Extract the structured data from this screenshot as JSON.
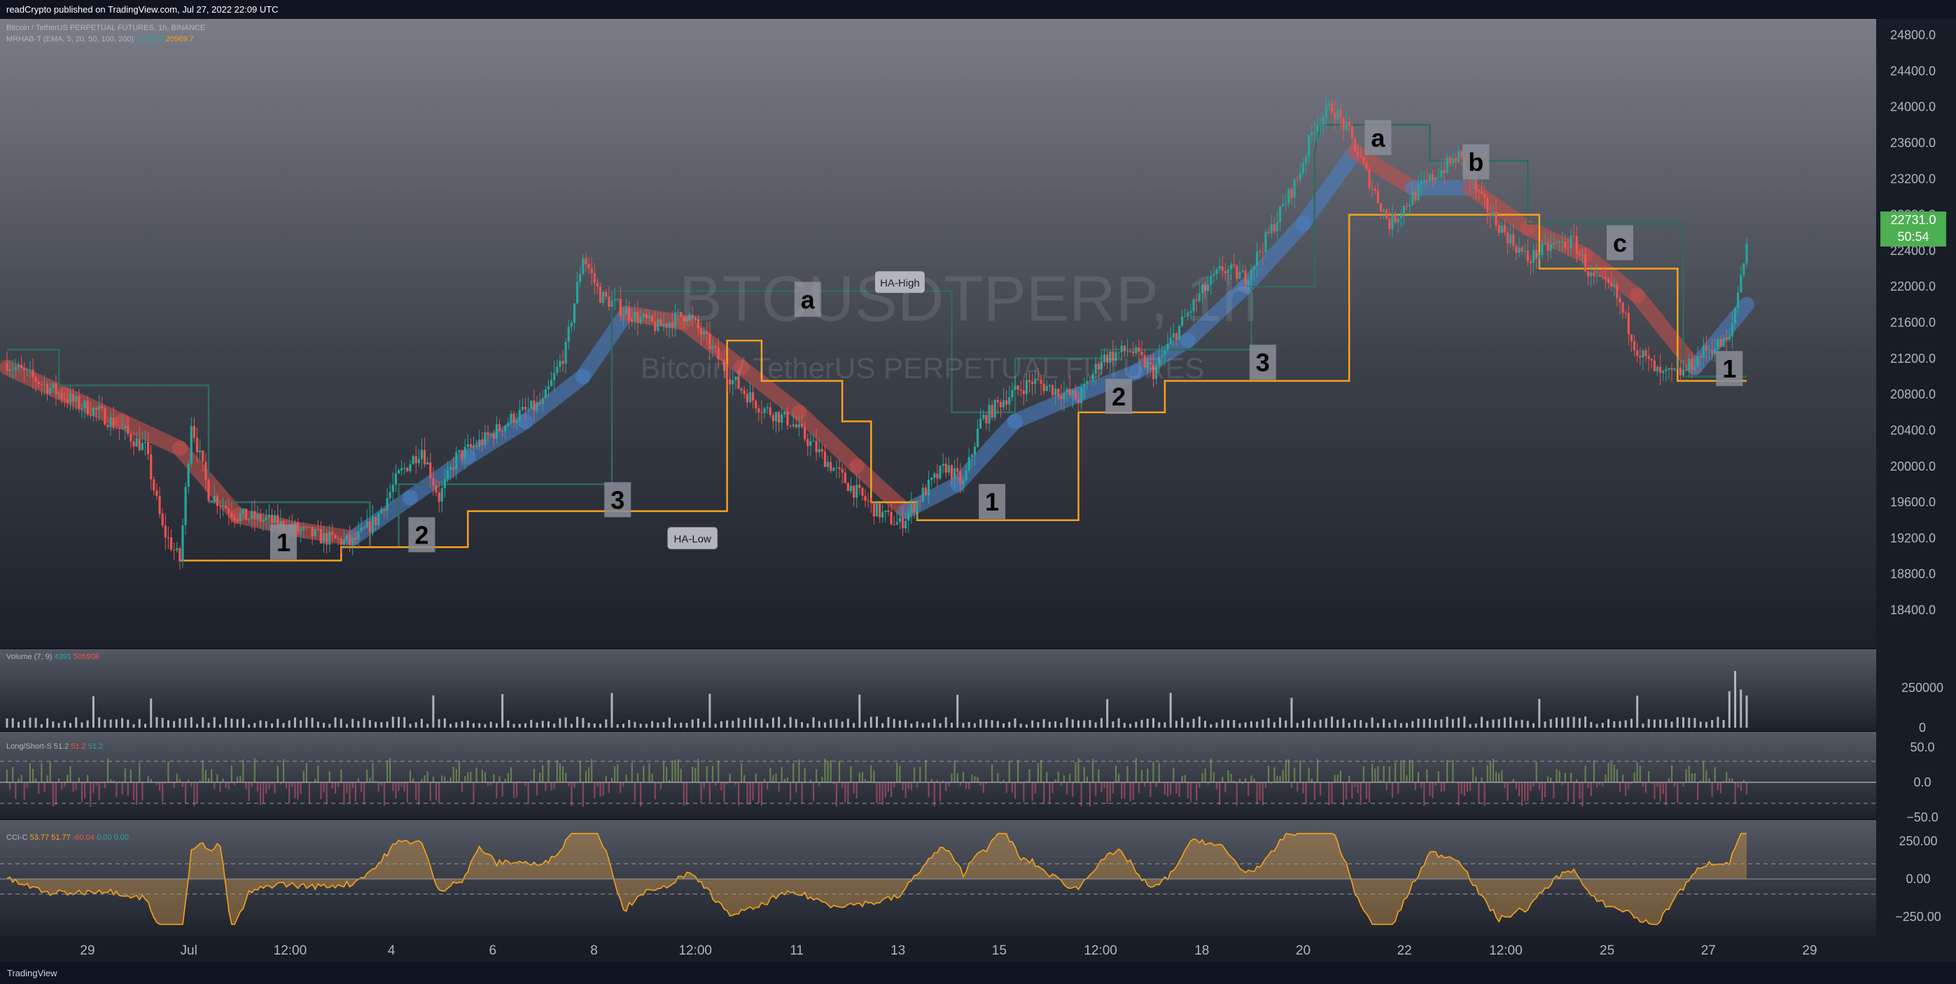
{
  "header_text": "readCrypto published on TradingView.com, Jul 27, 2022 22:09 UTC",
  "footer_logo": "TradingView",
  "symbol_legend": "Bitcoin / TetherUS PERPETUAL FUTURES, 1h, BINANCE",
  "indicator_legend": "MRHAB-T (EMA, 5, 20, 50, 100, 200)",
  "indicator_values": [
    "21248.2",
    "20969.7"
  ],
  "volume_legend": "Volume (7, 9)",
  "volume_values": [
    "4391",
    "505908"
  ],
  "ls_legend": "Long/Short-S",
  "ls_values": [
    "51.2",
    "51.2",
    "51.2"
  ],
  "cci_legend": "CCI-C",
  "cci_values": [
    "53.77",
    "51.77",
    "-60.04",
    "0.00",
    "0.00"
  ],
  "watermark_symbol": "BTCUSDTPERP, 1h",
  "watermark_name": "Bitcoin / TetherUS PERPETUAL FUTURES",
  "last_price": "22731.0",
  "countdown": "50:54",
  "colors": {
    "up": "#26a69a",
    "down": "#ef5350",
    "orange": "#f7a21b",
    "blue_ribbon": "#4a7fc1",
    "red_ribbon": "#c0504d",
    "darkgreen_line": "#2e6b5e",
    "cyan": "#25c5dc"
  },
  "chart_data": {
    "type": "candlestick",
    "price_axis": {
      "ticks": [
        18400,
        18800,
        19200,
        19600,
        20000,
        20400,
        20800,
        21200,
        21600,
        22000,
        22400,
        22800,
        23200,
        23600,
        24000,
        24400,
        24800
      ],
      "labels": [
        "18400.0",
        "18800.0",
        "19200.0",
        "19600.0",
        "20000.0",
        "20400.0",
        "20800.0",
        "21200.0",
        "21600.0",
        "22000.0",
        "22400.0",
        "22800.0",
        "23200.0",
        "23600.0",
        "24000.0",
        "24400.0",
        "24800.0"
      ],
      "ylim": [
        18000,
        25000
      ]
    },
    "time_axis": [
      "29",
      "Jul",
      "12:00",
      "4",
      "6",
      "8",
      "12:00",
      "11",
      "13",
      "15",
      "12:00",
      "18",
      "20",
      "22",
      "12:00",
      "25",
      "27",
      "29"
    ],
    "price_path": [
      [
        0,
        21150
      ],
      [
        8,
        21000
      ],
      [
        16,
        20850
      ],
      [
        24,
        20700
      ],
      [
        32,
        20600
      ],
      [
        40,
        20400
      ],
      [
        48,
        20200
      ],
      [
        54,
        19300
      ],
      [
        60,
        18950
      ],
      [
        64,
        20500
      ],
      [
        70,
        19700
      ],
      [
        80,
        19450
      ],
      [
        90,
        19400
      ],
      [
        100,
        19300
      ],
      [
        110,
        19200
      ],
      [
        120,
        19150
      ],
      [
        128,
        19400
      ],
      [
        136,
        19900
      ],
      [
        144,
        20200
      ],
      [
        150,
        19650
      ],
      [
        156,
        20100
      ],
      [
        166,
        20300
      ],
      [
        176,
        20550
      ],
      [
        186,
        20700
      ],
      [
        194,
        21300
      ],
      [
        200,
        22350
      ],
      [
        206,
        21900
      ],
      [
        216,
        21700
      ],
      [
        226,
        21550
      ],
      [
        236,
        21700
      ],
      [
        244,
        21350
      ],
      [
        252,
        20950
      ],
      [
        262,
        20650
      ],
      [
        272,
        20500
      ],
      [
        282,
        20150
      ],
      [
        292,
        19800
      ],
      [
        302,
        19500
      ],
      [
        310,
        19350
      ],
      [
        318,
        19700
      ],
      [
        326,
        20000
      ],
      [
        332,
        19800
      ],
      [
        338,
        20500
      ],
      [
        346,
        20750
      ],
      [
        356,
        20950
      ],
      [
        364,
        20850
      ],
      [
        372,
        20750
      ],
      [
        380,
        21200
      ],
      [
        390,
        21300
      ],
      [
        398,
        21050
      ],
      [
        406,
        21500
      ],
      [
        414,
        21900
      ],
      [
        422,
        22200
      ],
      [
        430,
        22100
      ],
      [
        440,
        22700
      ],
      [
        448,
        23200
      ],
      [
        454,
        23800
      ],
      [
        460,
        24000
      ],
      [
        466,
        23700
      ],
      [
        472,
        23250
      ],
      [
        480,
        22700
      ],
      [
        488,
        23000
      ],
      [
        496,
        23250
      ],
      [
        504,
        23450
      ],
      [
        512,
        22950
      ],
      [
        520,
        22600
      ],
      [
        528,
        22300
      ],
      [
        536,
        22450
      ],
      [
        544,
        22500
      ],
      [
        550,
        22100
      ],
      [
        558,
        21950
      ],
      [
        566,
        21300
      ],
      [
        574,
        21000
      ],
      [
        582,
        21050
      ],
      [
        590,
        21300
      ],
      [
        598,
        21400
      ],
      [
        604,
        22500
      ]
    ],
    "ema_ribbon_path": [
      [
        0,
        21100
      ],
      [
        20,
        20800
      ],
      [
        40,
        20500
      ],
      [
        60,
        20200
      ],
      [
        80,
        19450
      ],
      [
        100,
        19300
      ],
      [
        120,
        19200
      ],
      [
        140,
        19650
      ],
      [
        160,
        20100
      ],
      [
        180,
        20500
      ],
      [
        200,
        21000
      ],
      [
        215,
        21700
      ],
      [
        235,
        21600
      ],
      [
        255,
        21100
      ],
      [
        275,
        20600
      ],
      [
        295,
        20000
      ],
      [
        312,
        19500
      ],
      [
        330,
        19800
      ],
      [
        350,
        20500
      ],
      [
        372,
        20800
      ],
      [
        392,
        21050
      ],
      [
        410,
        21400
      ],
      [
        430,
        22000
      ],
      [
        450,
        22700
      ],
      [
        468,
        23500
      ],
      [
        488,
        23100
      ],
      [
        508,
        23100
      ],
      [
        528,
        22650
      ],
      [
        548,
        22350
      ],
      [
        566,
        21900
      ],
      [
        586,
        21100
      ],
      [
        604,
        21800
      ]
    ],
    "ha_low_steps": [
      [
        60,
        18950
      ],
      [
        116,
        18950
      ],
      [
        116,
        19100
      ],
      [
        160,
        19100
      ],
      [
        160,
        19500
      ],
      [
        250,
        19500
      ],
      [
        250,
        21400
      ],
      [
        262,
        21400
      ],
      [
        262,
        20950
      ],
      [
        290,
        20950
      ],
      [
        290,
        20500
      ],
      [
        300,
        20500
      ],
      [
        300,
        19600
      ],
      [
        316,
        19600
      ],
      [
        316,
        19400
      ],
      [
        372,
        19400
      ],
      [
        372,
        20600
      ],
      [
        402,
        20600
      ],
      [
        402,
        20950
      ],
      [
        466,
        20950
      ],
      [
        466,
        22800
      ],
      [
        532,
        22800
      ],
      [
        532,
        22200
      ],
      [
        580,
        22200
      ],
      [
        580,
        20950
      ],
      [
        604,
        20950
      ]
    ],
    "ha_high_steps": [
      [
        0,
        21300
      ],
      [
        18,
        21300
      ],
      [
        18,
        20900
      ],
      [
        70,
        20900
      ],
      [
        70,
        19600
      ],
      [
        126,
        19600
      ],
      [
        126,
        19100
      ],
      [
        136,
        19100
      ],
      [
        136,
        19800
      ],
      [
        210,
        19800
      ],
      [
        210,
        21950
      ],
      [
        328,
        21950
      ],
      [
        328,
        20600
      ],
      [
        350,
        20600
      ],
      [
        350,
        21200
      ],
      [
        380,
        21200
      ],
      [
        380,
        21300
      ],
      [
        432,
        21300
      ],
      [
        432,
        22000
      ],
      [
        454,
        22000
      ],
      [
        454,
        23500
      ],
      [
        456,
        23800
      ],
      [
        494,
        23800
      ],
      [
        494,
        23400
      ],
      [
        528,
        23400
      ],
      [
        528,
        22700
      ],
      [
        582,
        22700
      ],
      [
        582,
        21000
      ],
      [
        604,
        21000
      ]
    ],
    "wave_labels": [
      {
        "text": "1",
        "x": 96,
        "price": 19150
      },
      {
        "text": "2",
        "x": 144,
        "price": 19230
      },
      {
        "text": "3",
        "x": 212,
        "price": 19620
      },
      {
        "text": "a",
        "x": 278,
        "price": 21850
      },
      {
        "text": "1",
        "x": 342,
        "price": 19600
      },
      {
        "text": "2",
        "x": 386,
        "price": 20770
      },
      {
        "text": "3",
        "x": 436,
        "price": 21150
      },
      {
        "text": "a",
        "x": 476,
        "price": 23650
      },
      {
        "text": "b",
        "x": 510,
        "price": 23380
      },
      {
        "text": "c",
        "x": 560,
        "price": 22480
      },
      {
        "text": "1",
        "x": 598,
        "price": 21080
      }
    ],
    "callouts": [
      {
        "text": "HA-High",
        "x": 310,
        "price": 22050
      },
      {
        "text": "HA-Low",
        "x": 238,
        "price": 19200
      }
    ],
    "volume_axis": {
      "labels": [
        "250000",
        "0"
      ],
      "values": [
        250000,
        0
      ]
    },
    "ls_axis": {
      "labels": [
        "50.0",
        "0.0",
        "−50.0"
      ],
      "values": [
        50,
        0,
        -50
      ]
    },
    "cci_axis": {
      "labels": [
        "250.00",
        "0.00",
        "−250.00"
      ],
      "values": [
        250,
        0,
        -250
      ]
    }
  }
}
